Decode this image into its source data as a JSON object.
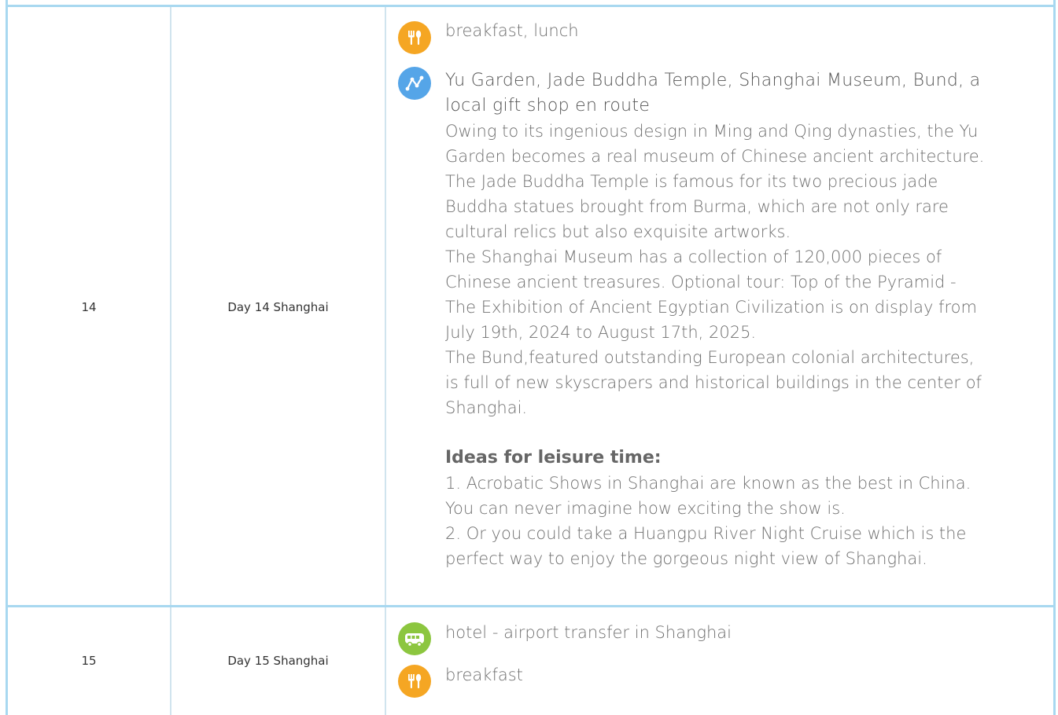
{
  "rows": [
    {
      "number": "14",
      "day": "Day 14 Shanghai",
      "meals": "breakfast, lunch",
      "sights_title": "Yu Garden, Jade Buddha Temple, Shanghai Museum, Bund, a local gift shop en route",
      "descriptions": [
        "Owing to its ingenious design in Ming and Qing dynasties, the Yu Garden becomes a real museum of Chinese ancient architecture.",
        "The Jade Buddha Temple is famous for its two precious jade Buddha statues brought from Burma, which are not only rare cultural relics but also exquisite artworks.",
        "The Shanghai Museum has a collection of 120,000 pieces of Chinese ancient treasures. Optional tour: Top of the Pyramid - The Exhibition of Ancient Egyptian Civilization is on display from July 19th, 2024 to August 17th, 2025.",
        "The Bund,featured outstanding European colonial architectures, is full of new skyscrapers and historical buildings in the center of Shanghai."
      ],
      "leisure_title": "Ideas for leisure time:",
      "leisure_items": [
        "1. Acrobatic Shows in Shanghai are known as the best in China. You can never imagine how exciting the show is.",
        "2. Or you could take a Huangpu River Night Cruise which is the perfect way to enjoy the gorgeous night view of Shanghai."
      ]
    },
    {
      "number": "15",
      "day": "Day 15 Shanghai",
      "transfer": "hotel - airport transfer in Shanghai",
      "meals": "breakfast"
    }
  ],
  "icons": {
    "meal": "fork-knife-icon",
    "route": "route-icon",
    "transfer": "bus-icon"
  },
  "colors": {
    "border": "#a8d8f0",
    "meal_icon": "#f5a623",
    "route_icon": "#55a5e8",
    "bus_icon": "#8cc63f"
  }
}
